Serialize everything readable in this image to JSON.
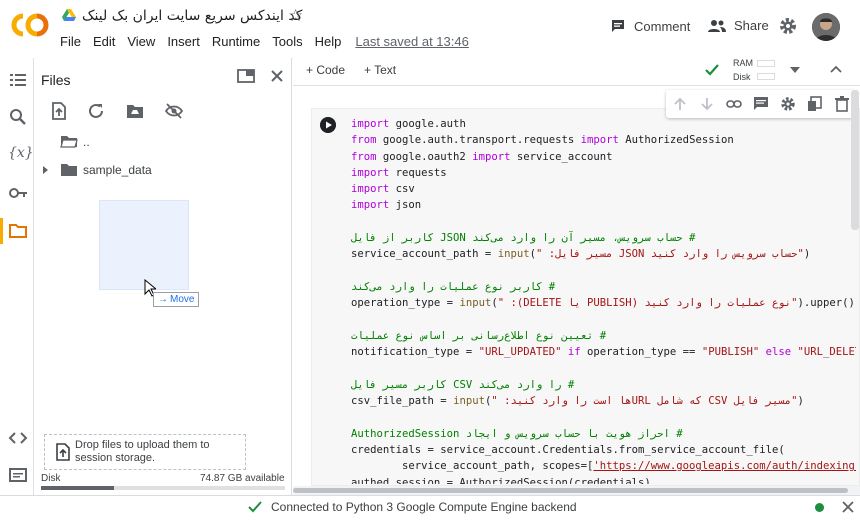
{
  "header": {
    "logo_text": "CO",
    "title": "کد ایندکس سریع سایت ایران بک لینک",
    "menu": [
      "File",
      "Edit",
      "View",
      "Insert",
      "Runtime",
      "Tools",
      "Help"
    ],
    "last_saved": "Last saved at 13:46",
    "comment_label": "Comment",
    "share_label": "Share"
  },
  "sidebar": {
    "rail_icons": [
      "toc-icon",
      "search-icon",
      "variables-icon",
      "key-icon",
      "folder-icon",
      "code-snippets-icon",
      "terminal-icon"
    ],
    "active_item": "folder-icon"
  },
  "files": {
    "title": "Files",
    "toolbar_icons": [
      "upload-icon",
      "refresh-icon",
      "mount-drive-icon",
      "hide-icon"
    ],
    "tree": [
      {
        "name": "..",
        "type": "folder"
      },
      {
        "name": "sample_data",
        "type": "folder",
        "collapsed": true
      }
    ],
    "drag_tooltip": "Move",
    "dropzone_text": "Drop files to upload them to session storage.",
    "disk_label": "Disk",
    "disk_available": "74.87 GB available",
    "disk_used_fraction": 0.3
  },
  "notebook": {
    "add_code": "+ Code",
    "add_text": "+ Text",
    "ram_label": "RAM",
    "disk_label": "Disk",
    "code_lines": [
      [
        [
          "kw",
          "import"
        ],
        [
          "tx",
          " google.auth"
        ]
      ],
      [
        [
          "kw",
          "from"
        ],
        [
          "tx",
          " google.auth.transport.requests "
        ],
        [
          "kw",
          "import"
        ],
        [
          "tx",
          " AuthorizedSession"
        ]
      ],
      [
        [
          "kw",
          "from"
        ],
        [
          "tx",
          " google.oauth2 "
        ],
        [
          "kw",
          "import"
        ],
        [
          "tx",
          " service_account"
        ]
      ],
      [
        [
          "kw",
          "import"
        ],
        [
          "tx",
          " requests"
        ]
      ],
      [
        [
          "kw",
          "import"
        ],
        [
          "tx",
          " csv"
        ]
      ],
      [
        [
          "kw",
          "import"
        ],
        [
          "tx",
          " json"
        ]
      ],
      [],
      [
        [
          "cm",
          "# حساب سرویس، مسیر آن را وارد می‌کند JSON کاربر از فایل"
        ]
      ],
      [
        [
          "tx",
          "service_account_path = "
        ],
        [
          "fn",
          "input"
        ],
        [
          "tx",
          "("
        ],
        [
          "st",
          "\"حساب سرویس را وارد کنید JSON مسیر فایل: \""
        ],
        [
          "tx",
          ")"
        ]
      ],
      [],
      [
        [
          "cm",
          "# کاربر نوع عملیات را وارد می‌کند"
        ]
      ],
      [
        [
          "tx",
          "operation_type = "
        ],
        [
          "fn",
          "input"
        ],
        [
          "tx",
          "("
        ],
        [
          "st",
          "\"نوع عملیات را وارد کنید (PUBLISH یا DELETE): \""
        ],
        [
          "tx",
          ").upper()"
        ]
      ],
      [],
      [
        [
          "cm",
          "# تعیین نوع اطلاع‌رسانی بر اساس نوع عملیات"
        ]
      ],
      [
        [
          "tx",
          "notification_type = "
        ],
        [
          "st",
          "\"URL_UPDATED\""
        ],
        [
          "kw",
          " if"
        ],
        [
          "tx",
          " operation_type == "
        ],
        [
          "st",
          "\"PUBLISH\""
        ],
        [
          "kw",
          " else"
        ],
        [
          "st",
          " \"URL_DELETED\""
        ]
      ],
      [],
      [
        [
          "cm",
          "# را وارد می‌کند CSV کاربر مسیر فایل"
        ]
      ],
      [
        [
          "tx",
          "csv_file_path = "
        ],
        [
          "fn",
          "input"
        ],
        [
          "tx",
          "("
        ],
        [
          "st",
          "\"مسیر فایل CSV که شامل URLها است را وارد کنید: \""
        ],
        [
          "tx",
          ")"
        ]
      ],
      [],
      [
        [
          "cm",
          "# احراز هویت با حساب سرویس و ایجاد AuthorizedSession"
        ]
      ],
      [
        [
          "tx",
          "credentials = service_account.Credentials.from_service_account_file("
        ]
      ],
      [
        [
          "tx",
          "        service_account_path, scopes=["
        ],
        [
          "url",
          "'https://www.googleapis.com/auth/indexing'"
        ],
        [
          "tx",
          "])"
        ]
      ],
      [
        [
          "tx",
          "authed_session = AuthorizedSession(credentials)"
        ]
      ]
    ]
  },
  "status": {
    "text": "Connected to Python 3 Google Compute Engine backend"
  },
  "colors": {
    "accent_orange": "#f9ab00",
    "keyword": "#af00db",
    "string": "#a31515",
    "comment": "#008000",
    "connected_green": "#1e8e3e"
  }
}
